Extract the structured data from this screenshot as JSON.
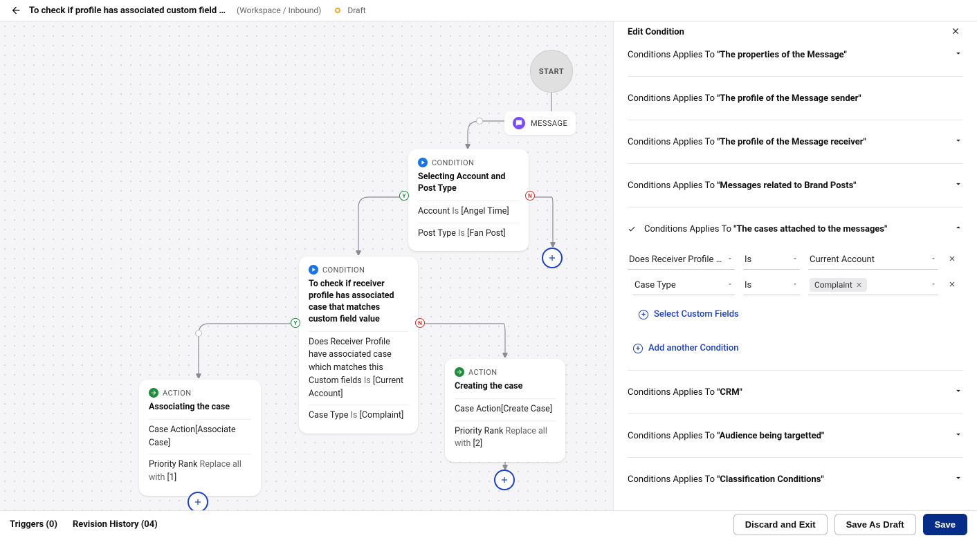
{
  "header": {
    "title": "To check if profile has associated custom field va...",
    "breadcrumb": "(Workspace / Inbound)",
    "status": "Draft"
  },
  "canvas": {
    "start": "START",
    "message_label": "MESSAGE",
    "nodes": {
      "cond1": {
        "type": "CONDITION",
        "title": "Selecting Account and Post Type",
        "lines": [
          {
            "field": "Account",
            "op": "Is",
            "value": "[Angel Time]"
          },
          {
            "field": "Post Type",
            "op": "Is",
            "value": "[Fan Post]"
          }
        ]
      },
      "cond2": {
        "type": "CONDITION",
        "title": "To check if receiver profile has associated case that matches custom field value",
        "lines": [
          {
            "field": "Does Receiver Profile have associated case which matches this Custom fields",
            "op": "Is",
            "value": "[Current Account]"
          },
          {
            "field": "Case Type",
            "op": "Is",
            "value": "[Complaint]"
          }
        ]
      },
      "act1": {
        "type": "ACTION",
        "title": "Associating the case",
        "lines": [
          {
            "field": "Case Action",
            "value": "[Associate Case]"
          },
          {
            "field": "Priority Rank",
            "op": "Replace all with",
            "value": "[1]"
          }
        ]
      },
      "act2": {
        "type": "ACTION",
        "title": "Creating the case",
        "lines": [
          {
            "field": "Case Action",
            "value": "[Create Case]"
          },
          {
            "field": "Priority Rank",
            "op": "Replace all with",
            "value": "[2]"
          }
        ]
      }
    },
    "yn": {
      "y": "Y",
      "n": "N"
    }
  },
  "panel": {
    "title": "Edit Condition",
    "applies_prefix": "Conditions Applies To ",
    "sections": [
      {
        "quoted": "\"The properties of the Message\""
      },
      {
        "quoted": "\"The profile of the Message sender\""
      },
      {
        "quoted": "\"The profile of the Message receiver\""
      },
      {
        "quoted": "\"Messages related to Brand Posts\""
      },
      {
        "quoted": "\"The cases attached to the messages\""
      },
      {
        "quoted": "\"CRM\""
      },
      {
        "quoted": "\"Audience being targetted\""
      },
      {
        "quoted": "\"Classification Conditions\""
      }
    ],
    "open": {
      "row1": {
        "field": "Does Receiver Profile h…",
        "op": "Is",
        "value": "Current Account"
      },
      "row2": {
        "field": "Case Type",
        "op": "Is",
        "chip": "Complaint"
      },
      "select_custom": "Select Custom Fields",
      "add_condition": "Add another Condition"
    }
  },
  "footer": {
    "triggers": "Triggers (0)",
    "revision": "Revision History (04)",
    "discard": "Discard and Exit",
    "draft": "Save As Draft",
    "save": "Save"
  }
}
